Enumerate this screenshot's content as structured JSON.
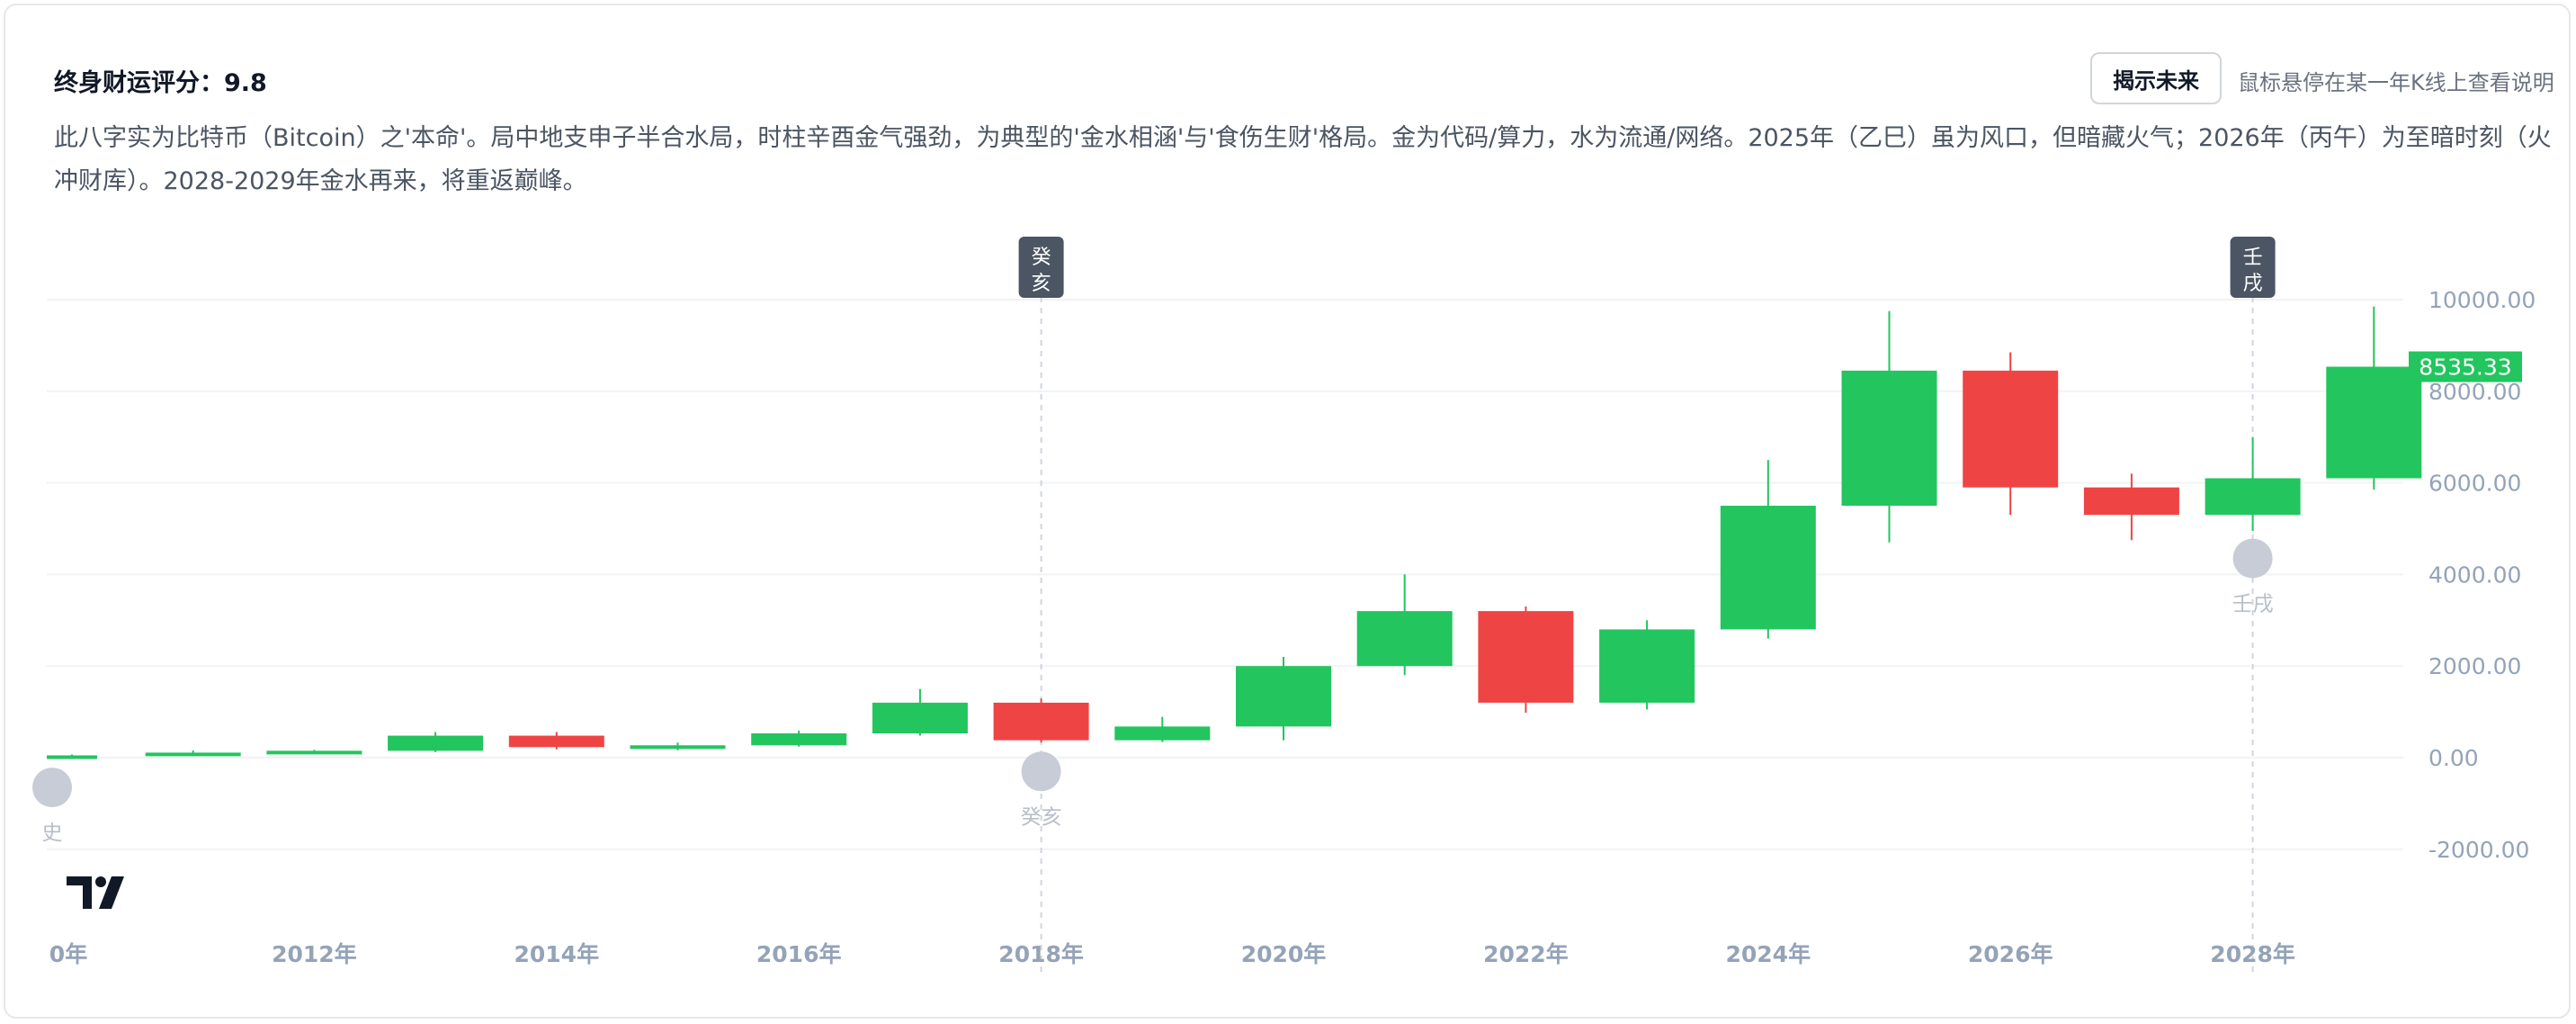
{
  "header": {
    "score_label": "终身财运评分：9.8",
    "reveal_button": "揭示未来",
    "hover_hint": "鼠标悬停在某一年K线上查看说明",
    "description": "此八字实为比特币（Bitcoin）之'本命'。局中地支申子半合水局，时柱辛酉金气强劲，为典型的'金水相涵'与'食伤生财'格局。金为代码/算力，水为流通/网络。2025年（乙巳）虽为风口，但暗藏火气；2026年（丙午）为至暗时刻（火冲财库）。2028-2029年金水再来，将重返巅峰。"
  },
  "colors": {
    "up": "#22c55e",
    "down": "#ef4444",
    "axis_text": "#94a3b8",
    "marker_badge": "#4b5563",
    "last_price_tag": "#22c55e"
  },
  "chart_data": {
    "type": "candlestick",
    "y_ticks": [
      "10000.00",
      "8000.00",
      "6000.00",
      "4000.00",
      "2000.00",
      "0.00",
      "-2000.00"
    ],
    "y_tick_values": [
      10000,
      8000,
      6000,
      4000,
      2000,
      0,
      -2000
    ],
    "ylim": [
      -3100,
      11300
    ],
    "x_ticks": [
      {
        "year": 2010,
        "label": "0年"
      },
      {
        "year": 2012,
        "label": "2012年"
      },
      {
        "year": 2014,
        "label": "2014年"
      },
      {
        "year": 2016,
        "label": "2016年"
      },
      {
        "year": 2018,
        "label": "2018年"
      },
      {
        "year": 2020,
        "label": "2020年"
      },
      {
        "year": 2022,
        "label": "2022年"
      },
      {
        "year": 2024,
        "label": "2024年"
      },
      {
        "year": 2026,
        "label": "2026年"
      },
      {
        "year": 2028,
        "label": "2028年"
      }
    ],
    "candles": [
      {
        "year": 2010,
        "open": 0,
        "close": 50,
        "high": 70,
        "low": -10
      },
      {
        "year": 2011,
        "open": 50,
        "close": 110,
        "high": 160,
        "low": 40
      },
      {
        "year": 2012,
        "open": 110,
        "close": 150,
        "high": 170,
        "low": 100
      },
      {
        "year": 2013,
        "open": 150,
        "close": 480,
        "high": 560,
        "low": 120
      },
      {
        "year": 2014,
        "open": 480,
        "close": 230,
        "high": 560,
        "low": 180
      },
      {
        "year": 2015,
        "open": 230,
        "close": 270,
        "high": 330,
        "low": 160
      },
      {
        "year": 2016,
        "open": 270,
        "close": 530,
        "high": 590,
        "low": 240
      },
      {
        "year": 2017,
        "open": 530,
        "close": 1200,
        "high": 1500,
        "low": 480
      },
      {
        "year": 2018,
        "open": 1200,
        "close": 380,
        "high": 1290,
        "low": 330
      },
      {
        "year": 2019,
        "open": 380,
        "close": 680,
        "high": 890,
        "low": 340
      },
      {
        "year": 2020,
        "open": 680,
        "close": 2000,
        "high": 2200,
        "low": 380
      },
      {
        "year": 2021,
        "open": 2000,
        "close": 3200,
        "high": 4000,
        "low": 1800
      },
      {
        "year": 2022,
        "open": 3200,
        "close": 1200,
        "high": 3300,
        "low": 980
      },
      {
        "year": 2023,
        "open": 1200,
        "close": 2800,
        "high": 3000,
        "low": 1050
      },
      {
        "year": 2024,
        "open": 2800,
        "close": 5500,
        "high": 6500,
        "low": 2600
      },
      {
        "year": 2025,
        "open": 5500,
        "close": 8450,
        "high": 9750,
        "low": 4700
      },
      {
        "year": 2026,
        "open": 8450,
        "close": 5900,
        "high": 8850,
        "low": 5300
      },
      {
        "year": 2027,
        "open": 5900,
        "close": 5300,
        "high": 6200,
        "low": 4750
      },
      {
        "year": 2028,
        "open": 5300,
        "close": 6100,
        "high": 7000,
        "low": 4950
      },
      {
        "year": 2029,
        "open": 6100,
        "close": 8535.33,
        "high": 9850,
        "low": 5850
      }
    ],
    "last_value_label": "8535.33",
    "last_value": 8535.33,
    "top_markers": [
      {
        "year": 2018,
        "line1": "癸",
        "line2": "亥"
      },
      {
        "year": 2028,
        "line1": "壬",
        "line2": "戌"
      }
    ],
    "circle_markers": [
      {
        "year": 2010,
        "value": -650,
        "label": "史"
      },
      {
        "year": 2018,
        "value": -300,
        "label": "癸亥"
      },
      {
        "year": 2028,
        "value": 4350,
        "label": "壬戌"
      }
    ]
  }
}
